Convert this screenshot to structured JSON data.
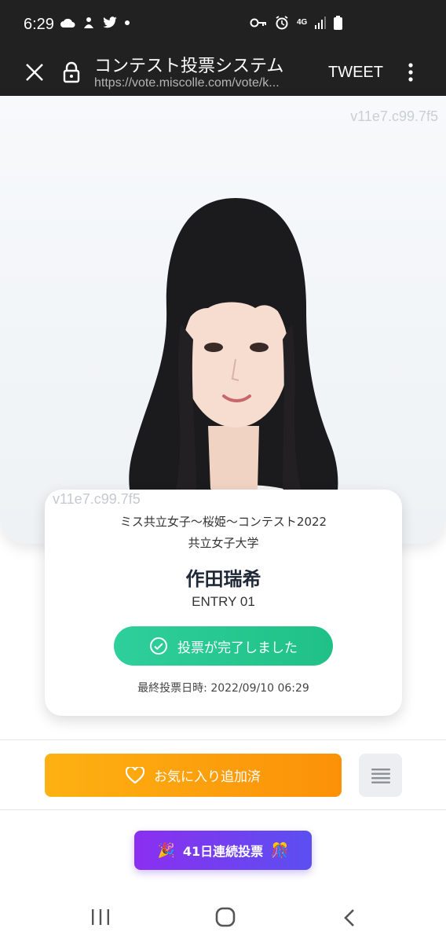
{
  "status_bar": {
    "time": "6:29",
    "network": "4G"
  },
  "browser": {
    "title": "コンテスト投票システム",
    "url": "https://vote.miscolle.com/vote/k...",
    "tweet_label": "TWEET"
  },
  "hero": {
    "watermark": "v11e7.c99.7f5"
  },
  "card": {
    "watermark": "v11e7.c99.7f5",
    "contest_name": "ミス共立女子〜桜姫〜コンテスト2022",
    "university": "共立女子大学",
    "candidate_name": "作田瑞希",
    "entry": "ENTRY 01",
    "vote_status": "投票が完了しました",
    "last_vote": "最終投票日時: 2022/09/10 06:29"
  },
  "actions": {
    "favorite_label": "お気に入り追加済"
  },
  "streak": {
    "label": "41日連続投票",
    "emoji_left": "🎉",
    "emoji_right": "🎊"
  },
  "colors": {
    "vote_green": "#20c088",
    "favorite_orange": "#fc9108",
    "streak_purple": "#8b2ff0",
    "browser_dark": "#212121"
  }
}
